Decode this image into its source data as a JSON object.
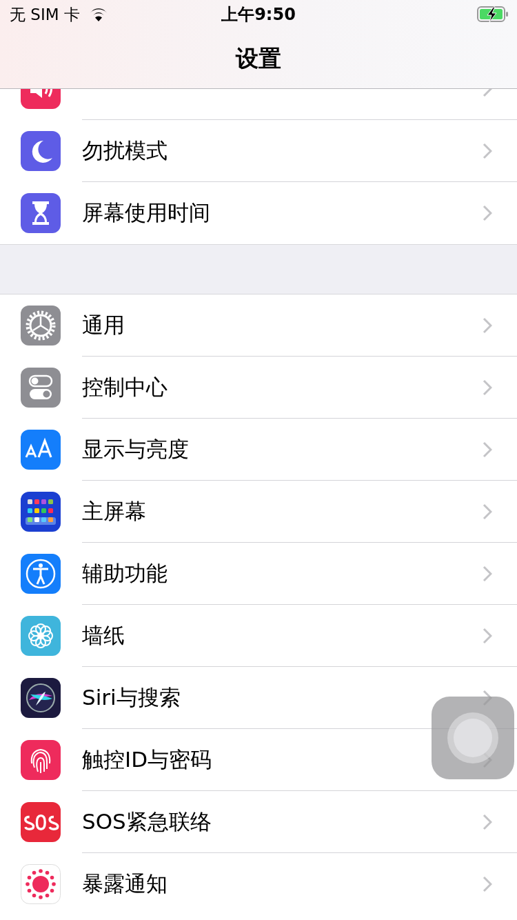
{
  "status_bar": {
    "carrier": "无 SIM 卡",
    "time": "上午9:50"
  },
  "nav_title": "设置",
  "groups": [
    {
      "items": [
        {
          "kind": "sound"
        },
        {
          "kind": "focus",
          "label": "勿扰模式"
        },
        {
          "kind": "screentime",
          "label": "屏幕使用时间"
        }
      ]
    },
    {
      "items": [
        {
          "kind": "general",
          "label": "通用"
        },
        {
          "kind": "control",
          "label": "控制中心"
        },
        {
          "kind": "display",
          "label": "显示与亮度"
        },
        {
          "kind": "home",
          "label": "主屏幕"
        },
        {
          "kind": "accessibility",
          "label": "辅助功能"
        },
        {
          "kind": "wallpaper",
          "label": "墙纸"
        },
        {
          "kind": "siri",
          "label": "Siri与搜索"
        },
        {
          "kind": "touchid",
          "label": "触控ID与密码"
        },
        {
          "kind": "sos",
          "label": "SOS紧急联络"
        },
        {
          "kind": "exposure",
          "label": "暴露通知"
        }
      ]
    }
  ]
}
